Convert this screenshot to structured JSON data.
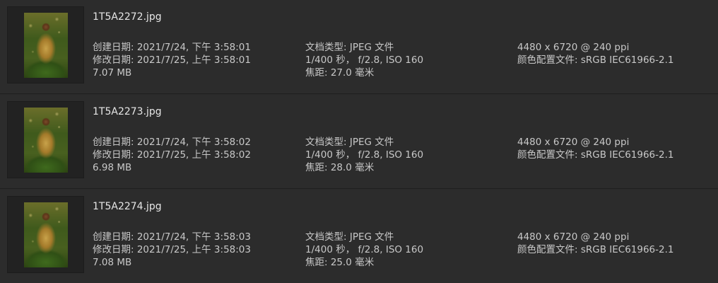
{
  "files": [
    {
      "name": "1T5A2272.jpg",
      "created": "创建日期: 2021/7/24, 下午 3:58:01",
      "modified": "修改日期: 2021/7/25, 上午 3:58:01",
      "size": "7.07 MB",
      "type": "文档类型: JPEG 文件",
      "exposure": "1/400 秒， f/2.8, ISO 160",
      "focal": "焦距: 27.0 毫米",
      "dimensions": "4480 x 6720 @ 240 ppi",
      "profile": "颜色配置文件: sRGB IEC61966-2.1"
    },
    {
      "name": "1T5A2273.jpg",
      "created": "创建日期: 2021/7/24, 下午 3:58:02",
      "modified": "修改日期: 2021/7/25, 上午 3:58:02",
      "size": "6.98 MB",
      "type": "文档类型: JPEG 文件",
      "exposure": "1/400 秒， f/2.8, ISO 160",
      "focal": "焦距: 28.0 毫米",
      "dimensions": "4480 x 6720 @ 240 ppi",
      "profile": "颜色配置文件: sRGB IEC61966-2.1"
    },
    {
      "name": "1T5A2274.jpg",
      "created": "创建日期: 2021/7/24, 下午 3:58:03",
      "modified": "修改日期: 2021/7/25, 上午 3:58:03",
      "size": "7.08 MB",
      "type": "文档类型: JPEG 文件",
      "exposure": "1/400 秒， f/2.8, ISO 160",
      "focal": "焦距: 25.0 毫米",
      "dimensions": "4480 x 6720 @ 240 ppi",
      "profile": "颜色配置文件: sRGB IEC61966-2.1"
    }
  ]
}
